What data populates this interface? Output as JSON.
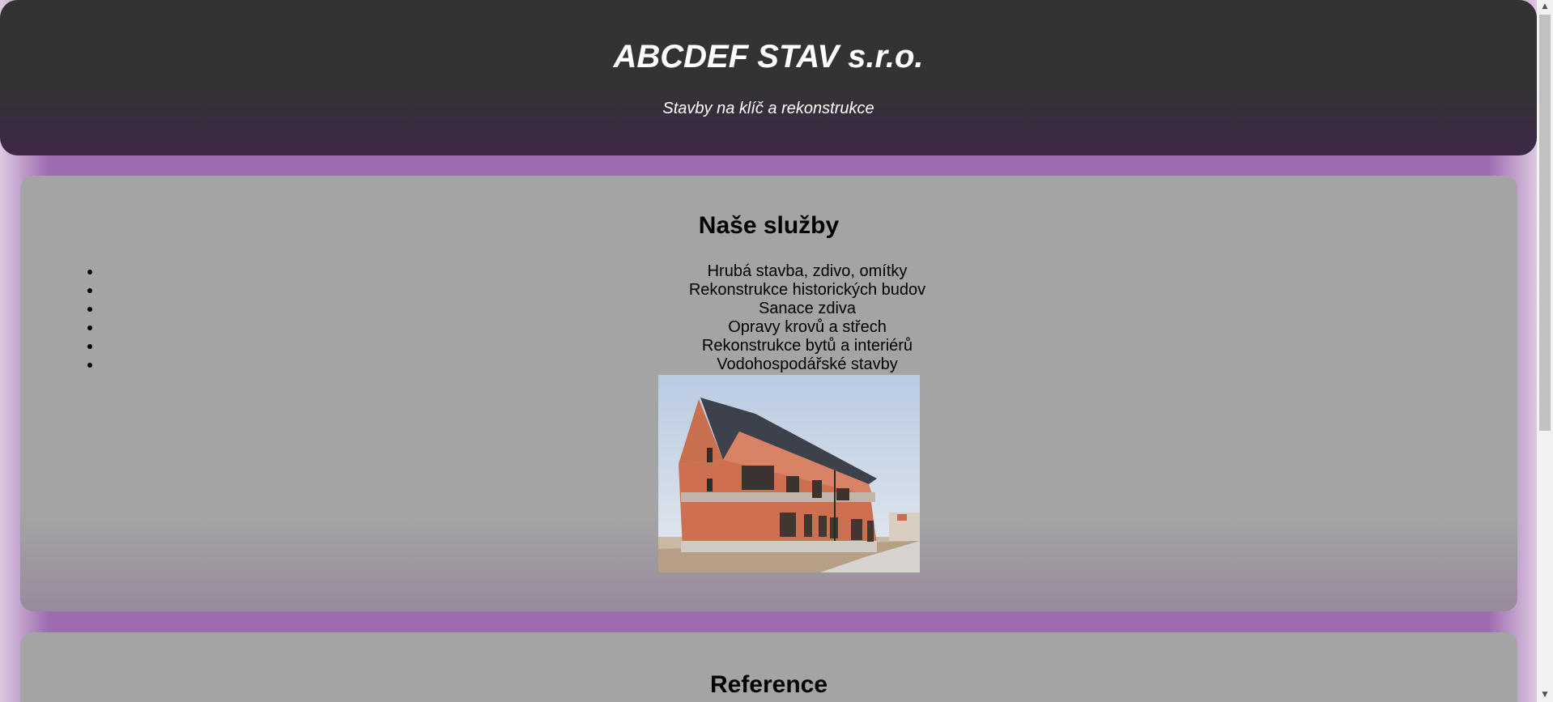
{
  "header": {
    "title": "ABCDEF STAV s.r.o.",
    "subtitle": "Stavby na klíč a rekonstrukce"
  },
  "services": {
    "heading": "Naše služby",
    "items": [
      "Hrubá stavba, zdivo, omítky",
      "Rekonstrukce historických budov",
      "Sanace zdiva",
      "Opravy krovů a střech",
      "Rekonstrukce bytů a interiérů",
      "Vodohospodářské stavby"
    ],
    "image_icon": "house-under-construction-photo"
  },
  "reference": {
    "heading": "Reference"
  },
  "scrollbar": {
    "up_icon": "chevron-up-icon",
    "down_icon": "chevron-down-icon"
  },
  "colors": {
    "header_bg": "#333333",
    "page_bg": "#9c6bb0",
    "card_bg": "#a4a4a4"
  }
}
